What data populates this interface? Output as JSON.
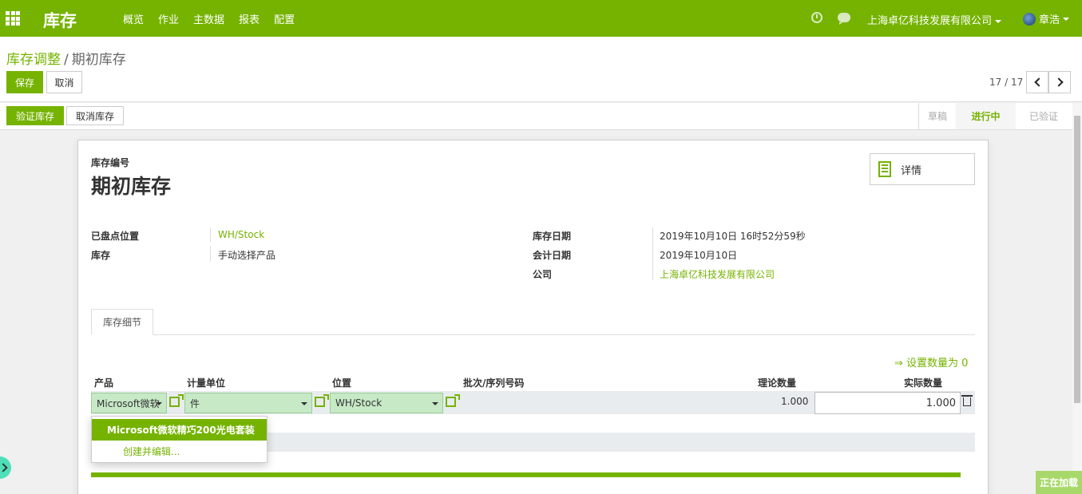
{
  "navbar": {
    "app_title": "库存",
    "menu": [
      "概览",
      "作业",
      "主数据",
      "报表",
      "配置"
    ],
    "company": "上海卓亿科技发展有限公司",
    "user": "章浩"
  },
  "breadcrumb": {
    "parent": "库存调整",
    "separator": "/",
    "current": "期初库存"
  },
  "buttons": {
    "save": "保存",
    "cancel": "取消",
    "validate": "验证库存",
    "cancel_inventory": "取消库存"
  },
  "pager": {
    "value": "17 / 17"
  },
  "stages": {
    "draft": "草稿",
    "in_progress": "进行中",
    "validated": "已验证",
    "current": "进行中"
  },
  "form": {
    "ref_label": "库存编号",
    "title": "期初库存",
    "smart_button": "详情",
    "fields_left": [
      {
        "label": "已盘点位置",
        "value": "WH/Stock"
      },
      {
        "label": "库存",
        "value": "手动选择产品"
      }
    ],
    "fields_right": [
      {
        "label": "库存日期",
        "value": "2019年10月10日 16时52分59秒"
      },
      {
        "label": "会计日期",
        "value": "2019年10月10日"
      },
      {
        "label": "公司",
        "value": "上海卓亿科技发展有限公司"
      }
    ]
  },
  "tabs": {
    "details": "库存细节"
  },
  "lines": {
    "set_zero": "⇒ 设置数量为 0",
    "headers": {
      "product": "产品",
      "uom": "计量单位",
      "location": "位置",
      "lot": "批次/序列号码",
      "theoretical": "理论数量",
      "actual": "实际数量"
    },
    "row": {
      "product": "Microsoft微软",
      "uom": "件",
      "location": "WH/Stock",
      "theoretical": "1.000",
      "actual": "1.000"
    }
  },
  "autocomplete": {
    "option": "Microsoft微软精巧200光电套装",
    "create": "创建并编辑..."
  },
  "loading": "正在加载",
  "colors": {
    "brand": "#75b300",
    "selection": "#c7e9c6"
  }
}
